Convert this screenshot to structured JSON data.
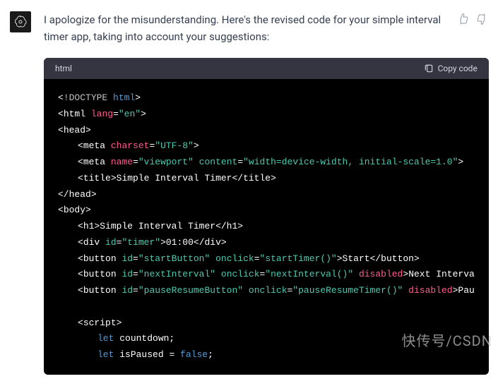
{
  "message": "I apologize for the misunderstanding. Here's the revised code for your simple interval timer app, taking into account your suggestions:",
  "code_header": {
    "lang": "html",
    "copy_label": "Copy code"
  },
  "code": {
    "doctype_kw": "!DOCTYPE",
    "doctype_html": "html",
    "html_tag": "html",
    "lang_attr": "lang",
    "lang_val": "\"en\"",
    "head_tag": "head",
    "meta_tag": "meta",
    "charset_attr": "charset",
    "charset_val": "\"UTF-8\"",
    "name_attr": "name",
    "viewport_val": "\"viewport\"",
    "content_attr": "content",
    "content_val": "\"width=device-width, initial-scale=1.0\"",
    "title_tag": "title",
    "title_text": "Simple Interval Timer",
    "body_tag": "body",
    "h1_tag": "h1",
    "h1_text": "Simple Interval Timer",
    "div_tag": "div",
    "id_attr": "id",
    "timer_id": "\"timer\"",
    "timer_text": "01:00",
    "button_tag": "button",
    "start_id": "\"startButton\"",
    "onclick_attr": "onclick",
    "start_fn": "\"startTimer()\"",
    "start_text": "Start",
    "next_id": "\"nextInterval\"",
    "next_fn": "\"nextInterval()\"",
    "disabled_attr": "disabled",
    "next_text": "Next Interva",
    "pause_id": "\"pauseResumeButton\"",
    "pause_fn": "\"pauseResumeTimer()\"",
    "pause_text": "Pau",
    "script_tag": "script",
    "let_kw": "let",
    "countdown_var": "countdown;",
    "ispaused_var": "isPaused",
    "false_val": "false"
  },
  "watermark": "快传号/CSDN"
}
